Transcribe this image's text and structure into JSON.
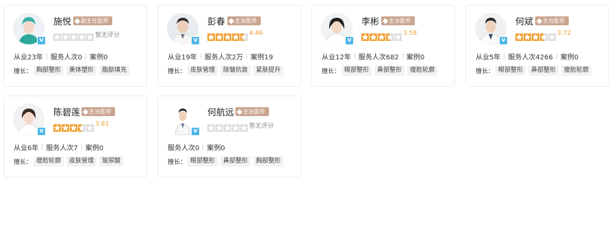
{
  "colors": {
    "star_filled": "#f0a030",
    "star_empty": "#dcdcdc",
    "badge": "#c9a48e",
    "verified": "#4fb7e8"
  },
  "doctors": [
    {
      "name": "施悦",
      "title": "副主任医师",
      "stars_filled": 0,
      "rating_text": "暂无评分",
      "stats": [
        "从业23年",
        "服务人次0",
        "案例0"
      ],
      "tags_label": "擅长：",
      "tags": [
        "胸部整形",
        "美体塑形",
        "脂肪填充"
      ]
    },
    {
      "name": "彭春",
      "title": "主治医师",
      "stars_filled": 4.5,
      "rating_text": "4.46",
      "stats": [
        "从业19年",
        "服务人次2万",
        "案例19"
      ],
      "tags_label": "擅长：",
      "tags": [
        "皮肤管理",
        "除皱抗衰",
        "紧肤提升"
      ]
    },
    {
      "name": "李彬",
      "title": "主治医师",
      "stars_filled": 3.5,
      "rating_text": "3.58",
      "stats": [
        "从业12年",
        "服务人次682",
        "案例0"
      ],
      "tags_label": "擅长：",
      "tags": [
        "眼部整形",
        "鼻部整形",
        "瘦脸轮廓"
      ]
    },
    {
      "name": "何斌",
      "title": "主治医师",
      "stars_filled": 3.5,
      "rating_text": "3.72",
      "stats": [
        "从业5年",
        "服务人次4266",
        "案例0"
      ],
      "tags_label": "擅长：",
      "tags": [
        "眼部整形",
        "鼻部整形",
        "瘦脸轮廓"
      ]
    },
    {
      "name": "陈碧莲",
      "title": "主治医师",
      "stars_filled": 3.5,
      "rating_text": "3.81",
      "stats": [
        "从业6年",
        "服务人次7",
        "案例0"
      ],
      "tags_label": "擅长：",
      "tags": [
        "瘦脸轮廓",
        "皮肤管理",
        "玻尿酸"
      ]
    },
    {
      "name": "何航远",
      "title": "主治医师",
      "stars_filled": 0,
      "rating_text": "暂无评分",
      "stats": [
        "服务人次0",
        "案例0"
      ],
      "tags_label": "擅长：",
      "tags": [
        "眼部整形",
        "鼻部整形",
        "胸部整形"
      ]
    }
  ]
}
